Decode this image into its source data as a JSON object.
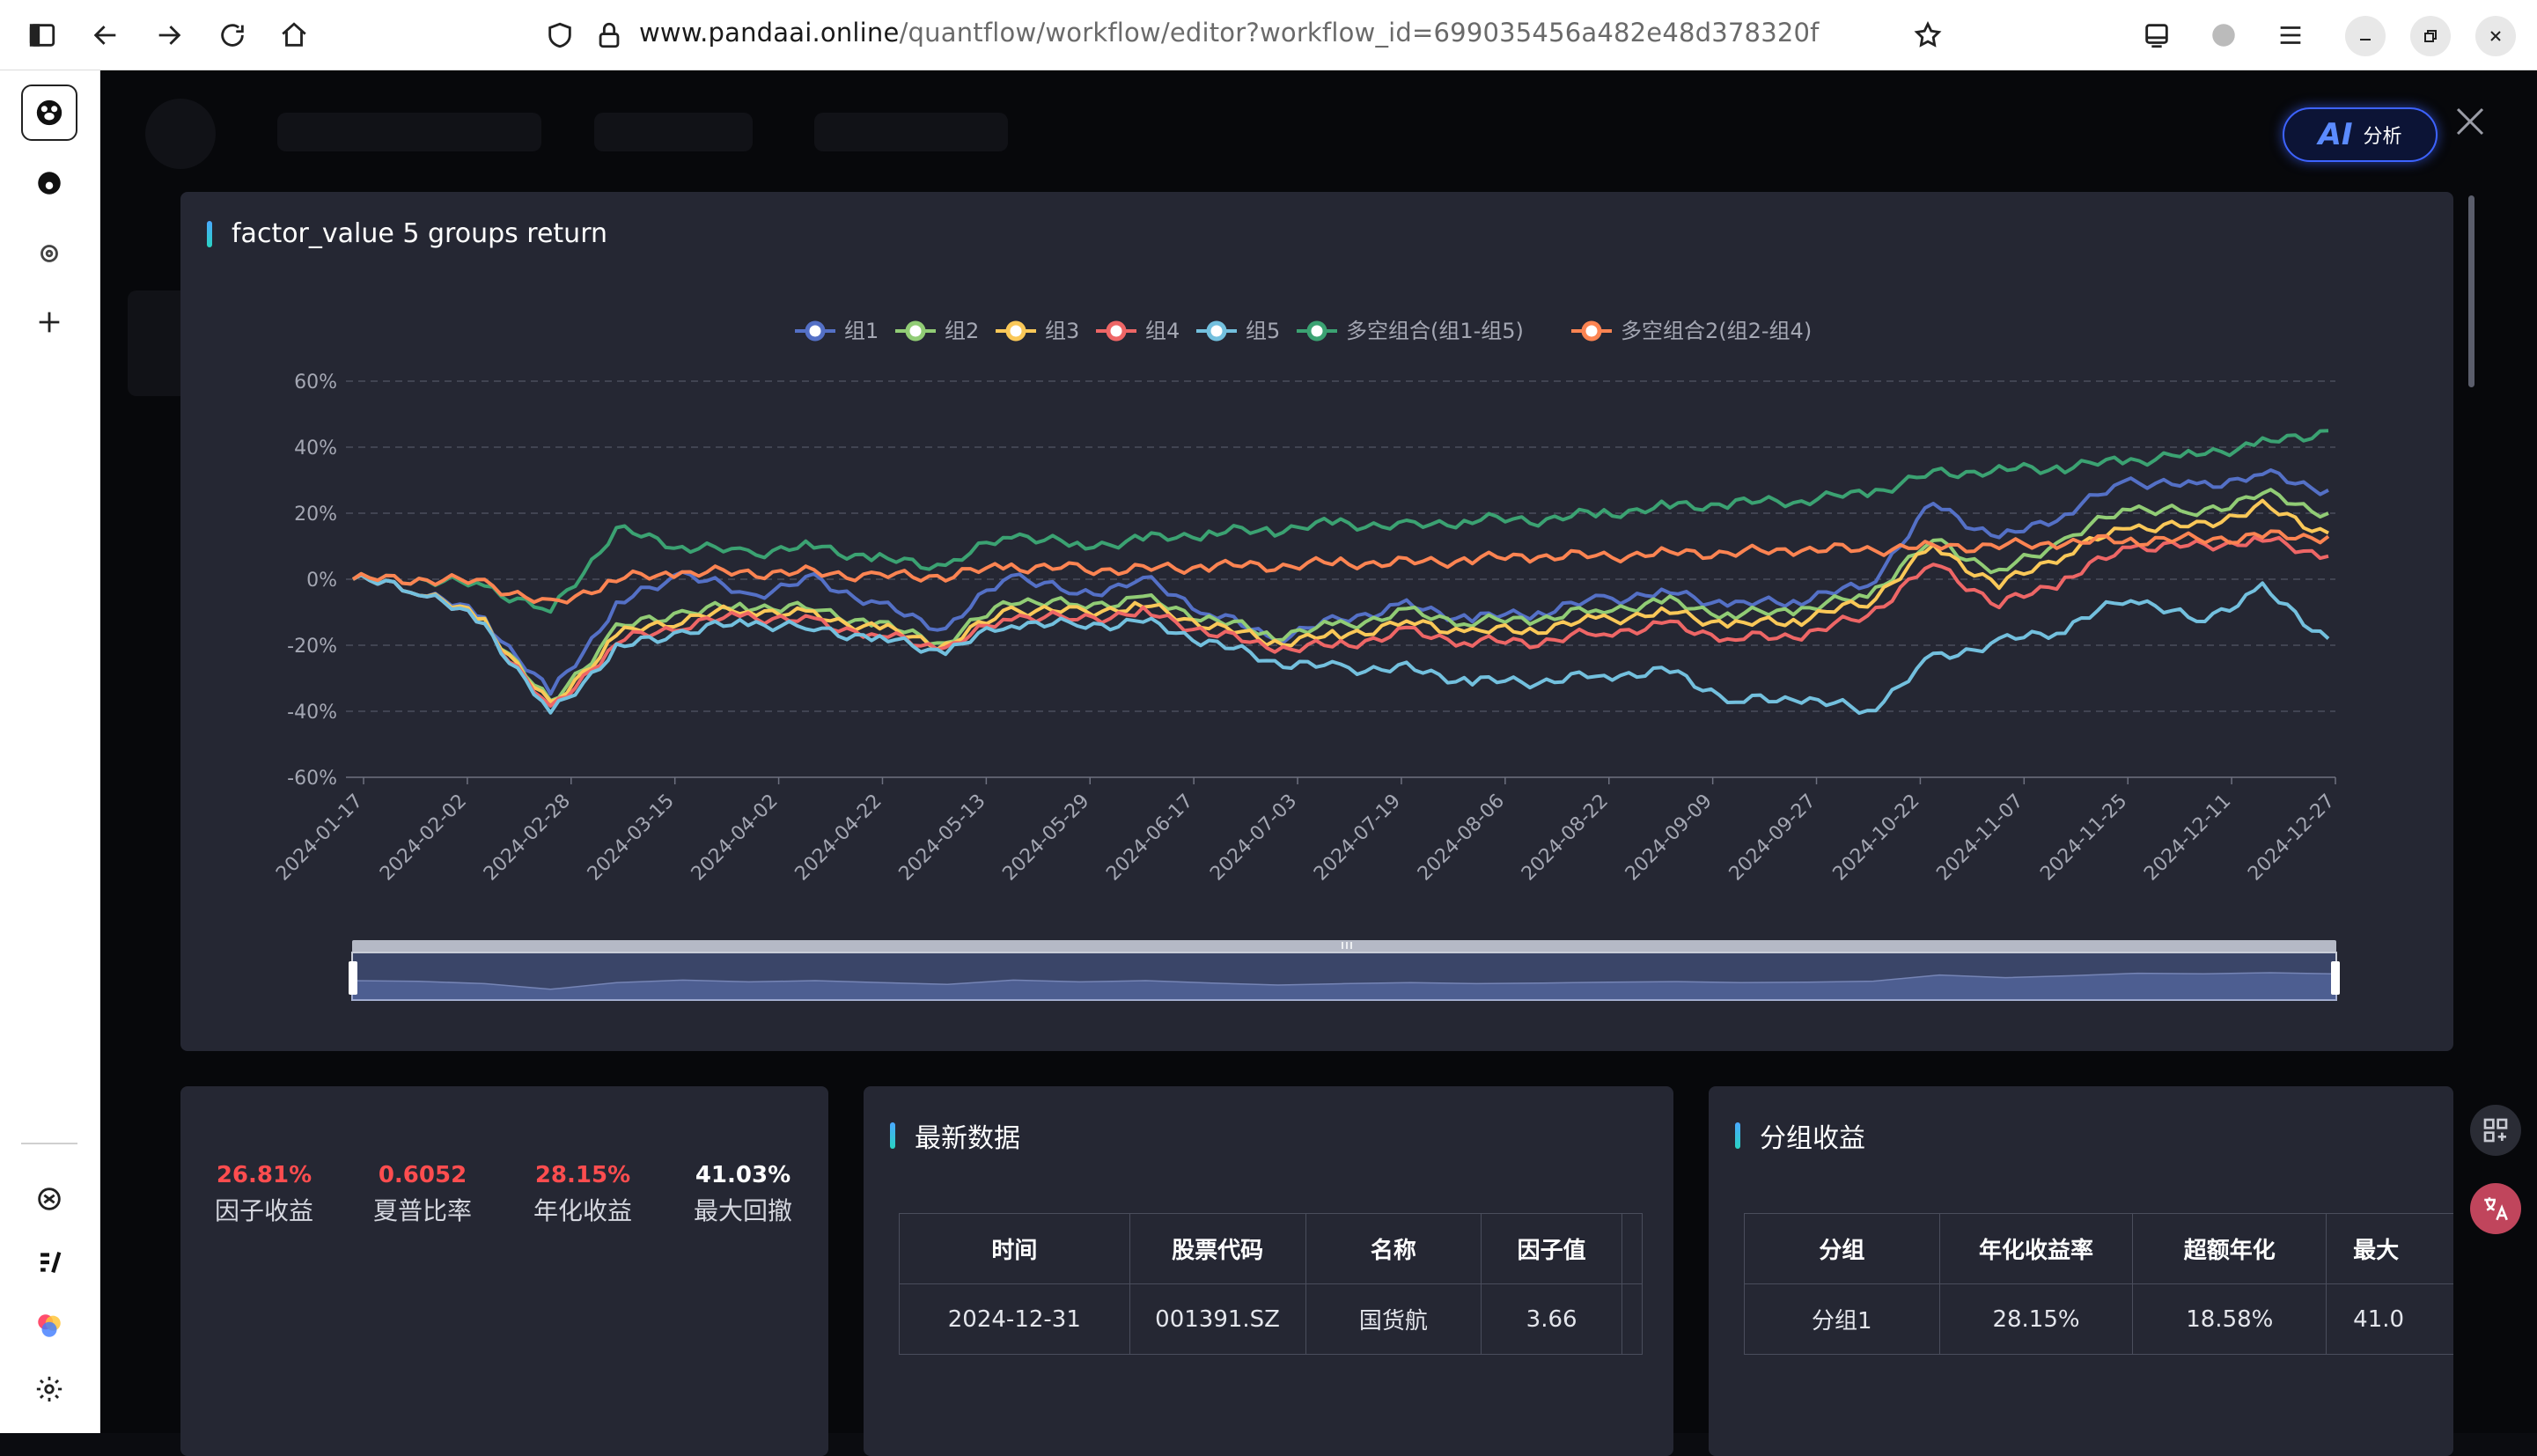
{
  "browser": {
    "url_host": "www.pandaai.online",
    "url_path": "/quantflow/workflow/editor?workflow_id=699035456a482e48d378320f"
  },
  "ai_button": {
    "icon_text": "AI",
    "label": "分析"
  },
  "chart_panel": {
    "title": "factor_value 5 groups return"
  },
  "chart_data": {
    "type": "line",
    "title": "factor_value 5 groups return",
    "ylim": [
      -60,
      60
    ],
    "yticks": [
      "60%",
      "40%",
      "20%",
      "0%",
      "-20%",
      "-40%",
      "-60%"
    ],
    "xticks": [
      "2024-01-17",
      "2024-02-02",
      "2024-02-28",
      "2024-03-15",
      "2024-04-02",
      "2024-04-22",
      "2024-05-13",
      "2024-05-29",
      "2024-06-17",
      "2024-07-03",
      "2024-07-19",
      "2024-08-06",
      "2024-08-22",
      "2024-09-09",
      "2024-09-27",
      "2024-10-22",
      "2024-11-07",
      "2024-11-25",
      "2024-12-11",
      "2024-12-27"
    ],
    "grid": true,
    "legend_position": "top",
    "series": [
      {
        "name": "组1",
        "color": "#5470c6",
        "values": [
          0,
          -3,
          -12,
          -35,
          -8,
          2,
          -5,
          0,
          -8,
          -15,
          2,
          -5,
          0,
          -10,
          -18,
          -12,
          -8,
          -12,
          -10,
          -6,
          -4,
          -8,
          -6,
          -2,
          23,
          12,
          20,
          30,
          28,
          32,
          27
        ]
      },
      {
        "name": "组2",
        "color": "#91cc75",
        "values": [
          0,
          -3,
          -13,
          -38,
          -15,
          -10,
          -8,
          -9,
          -14,
          -19,
          -6,
          -8,
          -6,
          -12,
          -17,
          -14,
          -10,
          -13,
          -12,
          -9,
          -7,
          -11,
          -9,
          -5,
          12,
          2,
          12,
          22,
          20,
          26,
          20
        ]
      },
      {
        "name": "组3",
        "color": "#fac858",
        "values": [
          0,
          -3,
          -13,
          -39,
          -17,
          -12,
          -9,
          -11,
          -15,
          -20,
          -9,
          -10,
          -8,
          -14,
          -19,
          -17,
          -13,
          -16,
          -15,
          -12,
          -10,
          -14,
          -12,
          -7,
          10,
          -2,
          8,
          16,
          16,
          22,
          14
        ]
      },
      {
        "name": "组4",
        "color": "#ee6666",
        "values": [
          0,
          -3,
          -14,
          -40,
          -19,
          -14,
          -11,
          -13,
          -17,
          -21,
          -11,
          -12,
          -10,
          -16,
          -21,
          -20,
          -16,
          -19,
          -19,
          -16,
          -14,
          -18,
          -17,
          -11,
          5,
          -8,
          0,
          10,
          10,
          12,
          7
        ]
      },
      {
        "name": "组5",
        "color": "#73c0de",
        "values": [
          0,
          -3,
          -14,
          -41,
          -21,
          -16,
          -13,
          -15,
          -18,
          -22,
          -13,
          -14,
          -13,
          -19,
          -25,
          -27,
          -27,
          -31,
          -31,
          -29,
          -28,
          -37,
          -36,
          -40,
          -24,
          -19,
          -15,
          -5,
          -13,
          -3,
          -18
        ]
      },
      {
        "name": "多空组合(组1-组5)",
        "color": "#3ba272",
        "values": [
          0,
          0,
          -2,
          -10,
          15,
          10,
          8,
          10,
          6,
          4,
          14,
          10,
          12,
          14,
          15,
          17,
          16,
          18,
          18,
          20,
          22,
          23,
          24,
          26,
          32,
          33,
          34,
          36,
          38,
          41,
          45
        ]
      },
      {
        "name": "多空组合2(组2-组4)",
        "color": "#fc8452",
        "values": [
          0,
          0,
          -1,
          -8,
          0,
          2,
          2,
          2,
          1,
          1,
          4,
          3,
          3,
          4,
          4,
          5,
          5,
          6,
          7,
          7,
          8,
          8,
          9,
          9,
          10,
          10,
          11,
          12,
          12,
          13,
          13
        ]
      }
    ]
  },
  "stats": [
    {
      "value": "26.81%",
      "label": "因子收益"
    },
    {
      "value": "0.6052",
      "label": "夏普比率"
    },
    {
      "value": "28.15%",
      "label": "年化收益"
    },
    {
      "value": "41.03%",
      "label": "最大回撤"
    }
  ],
  "latest_panel": {
    "title": "最新数据",
    "headers": [
      "时间",
      "股票代码",
      "名称",
      "因子值"
    ],
    "rows": [
      [
        "2024-12-31",
        "001391.SZ",
        "国货航",
        "3.66"
      ]
    ]
  },
  "group_panel": {
    "title": "分组收益",
    "headers": [
      "分组",
      "年化收益率",
      "超额年化",
      "最大"
    ],
    "rows": [
      [
        "分组1",
        "28.15%",
        "18.58%",
        "41.0"
      ]
    ]
  }
}
